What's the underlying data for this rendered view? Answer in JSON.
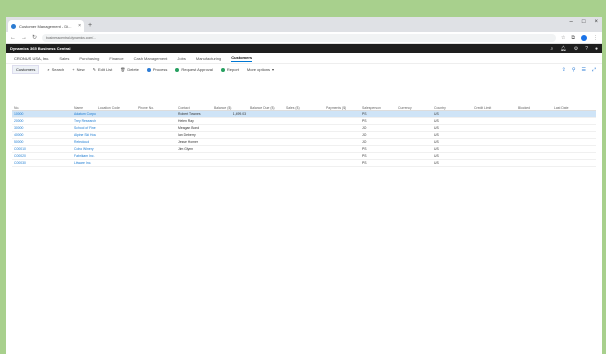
{
  "browser": {
    "tab_title": "Customer Management - Di...",
    "url": "businesscentral.dynamics.com/...",
    "window_controls": [
      "–",
      "□",
      "×"
    ]
  },
  "app": {
    "name": "Dynamics 365 Business Central"
  },
  "pagenav": {
    "company": "CRONUS USA, Inc.",
    "items": [
      "Sales",
      "Purchasing",
      "Finance",
      "Cash Management",
      "Jobs",
      "Manufacturing",
      "Customers"
    ]
  },
  "actionbar": {
    "page_title": "Customers",
    "actions": [
      "Search",
      "New",
      "Edit List",
      "Delete",
      "Process",
      "Request Approval",
      "Report",
      "More options"
    ]
  },
  "table": {
    "columns": [
      "No.",
      "Name",
      "Location Code",
      "Phone No.",
      "Contact",
      "Balance ($)",
      "Balance Due ($)",
      "Sales ($)",
      "Payments ($)",
      "Salesperson",
      "Currency",
      "Country",
      "Credit Limit",
      "Blocked",
      "Last Date"
    ],
    "rows": [
      [
        "10000",
        "Adatum Corporation",
        "",
        "",
        "Robert Townes",
        "1,499.03",
        "",
        "",
        "",
        "PS",
        "",
        "US",
        "",
        "",
        ""
      ],
      [
        "20000",
        "Trey Research",
        "",
        "",
        "Helen Ray",
        "",
        "",
        "",
        "",
        "PS",
        "",
        "US",
        "",
        "",
        ""
      ],
      [
        "30000",
        "School of Fine Art",
        "",
        "",
        "Meagan Bond",
        "",
        "",
        "",
        "",
        "JO",
        "",
        "US",
        "",
        "",
        ""
      ],
      [
        "40000",
        "Alpine Ski House",
        "",
        "",
        "Ian Deberry",
        "",
        "",
        "",
        "",
        "JO",
        "",
        "US",
        "",
        "",
        ""
      ],
      [
        "50000",
        "Relecloud",
        "",
        "",
        "Jesse Homer",
        "",
        "",
        "",
        "",
        "JO",
        "",
        "US",
        "",
        "",
        ""
      ],
      [
        "C00010",
        "Coho Winery",
        "",
        "",
        "Jim Glynn",
        "",
        "",
        "",
        "",
        "PS",
        "",
        "US",
        "",
        "",
        ""
      ],
      [
        "C00020",
        "Fabrikam Inc.",
        "",
        "",
        "",
        "",
        "",
        "",
        "",
        "PS",
        "",
        "US",
        "",
        "",
        ""
      ],
      [
        "C00030",
        "Litware Inc.",
        "",
        "",
        "",
        "",
        "",
        "",
        "",
        "PS",
        "",
        "US",
        "",
        "",
        ""
      ]
    ]
  }
}
